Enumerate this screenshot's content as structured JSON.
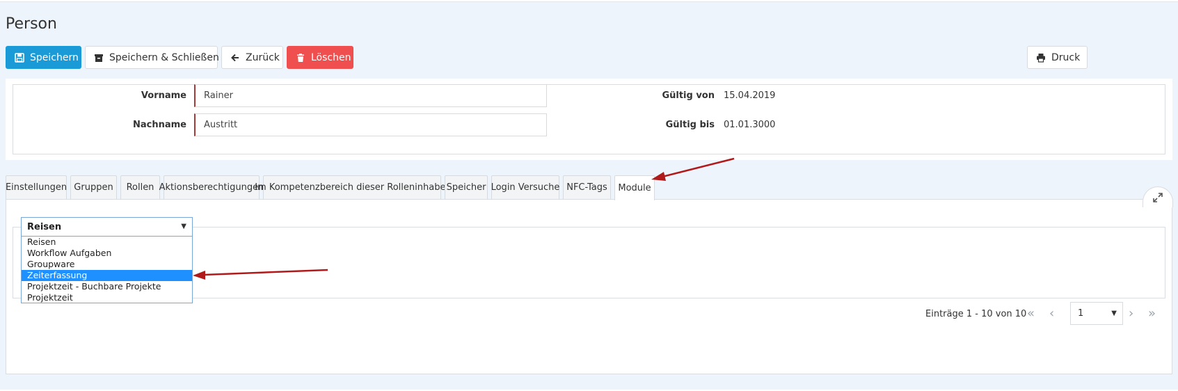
{
  "page": {
    "title": "Person"
  },
  "toolbar": {
    "save": "Speichern",
    "save_close": "Speichern & Schließen",
    "back": "Zurück",
    "delete": "Löschen",
    "print": "Druck"
  },
  "form": {
    "firstname_label": "Vorname",
    "firstname_value": "Rainer",
    "lastname_label": "Nachname",
    "lastname_value": "Austritt",
    "valid_from_label": "Gültig von",
    "valid_from_value": "15.04.2019",
    "valid_to_label": "Gültig bis",
    "valid_to_value": "01.01.3000"
  },
  "tabs": [
    {
      "label": "Einstellungen"
    },
    {
      "label": "Gruppen"
    },
    {
      "label": "Rollen"
    },
    {
      "label": "Aktionsberechtigungen"
    },
    {
      "label": "Im Kompetenzbereich dieser Rolleninhaber"
    },
    {
      "label": "Speicher"
    },
    {
      "label": "Login Versuche"
    },
    {
      "label": "NFC-Tags"
    },
    {
      "label": "Module",
      "active": true
    }
  ],
  "module_select": {
    "selected": "Reisen",
    "options": [
      "Reisen",
      "Workflow Aufgaben",
      "Groupware",
      "Zeiterfassung",
      "Projektzeit - Buchbare Projekte",
      "Projektzeit"
    ],
    "highlighted": "Zeiterfassung"
  },
  "pagination": {
    "summary": "Einträge 1 - 10 von 10",
    "page": "1"
  },
  "colors": {
    "primary": "#1a9ad6",
    "danger": "#ef4f4f",
    "annotation_arrow": "#b01a1a",
    "highlight": "#1e90ff"
  }
}
